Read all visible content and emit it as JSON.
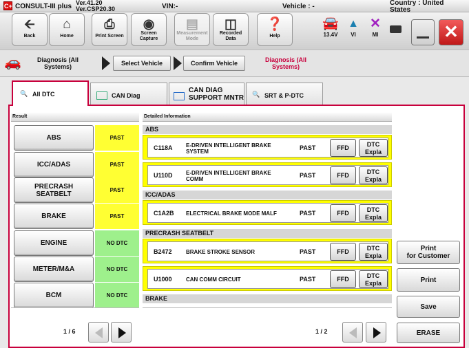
{
  "titlebar": {
    "logo": "C+",
    "app_name": "CONSULT-III plus",
    "ver_line1": "Ver.41.20",
    "ver_line2": "Ver.CSP20.30",
    "vin_label": "VIN:-",
    "vehicle_label": "Vehicle : -",
    "country_line1": "Country : United",
    "country_line2": "States"
  },
  "toolbar": {
    "back": "Back",
    "home": "Home",
    "print_screen": "Print Screen",
    "screen_capture": [
      "Screen",
      "Capture"
    ],
    "measurement_mode": [
      "Measurement",
      "Mode"
    ],
    "recorded_data": [
      "Recorded",
      "Data"
    ],
    "help": "Help",
    "battery_voltage": "13.4V",
    "vi_label": "VI",
    "mi_label": "MI"
  },
  "breadcrumb": {
    "diagnosis_all_systems": [
      "Diagnosis (All",
      "Systems)"
    ],
    "select_vehicle": "Select Vehicle",
    "confirm_vehicle": "Confirm Vehicle",
    "current": [
      "Diagnosis (All",
      "Systems)"
    ],
    "current_color": "#c8003c"
  },
  "tabs": {
    "all_dtc": "All DTC",
    "can_diag": "CAN Diag",
    "can_diag_support": [
      "CAN DIAG",
      "SUPPORT MNTR"
    ],
    "srt_pdtc": "SRT & P-DTC"
  },
  "result": {
    "header": "Result",
    "systems": [
      {
        "name": "ABS",
        "status": "PAST"
      },
      {
        "name": "ICC/ADAS",
        "status": "PAST"
      },
      {
        "name": "PRECRASH SEATBELT",
        "status": "PAST"
      },
      {
        "name": "BRAKE",
        "status": "PAST"
      },
      {
        "name": "ENGINE",
        "status": "NO DTC"
      },
      {
        "name": "METER/M&A",
        "status": "NO DTC"
      },
      {
        "name": "BCM",
        "status": "NO DTC"
      }
    ],
    "page": "1 / 6"
  },
  "detail": {
    "header": "Detailed Information",
    "groups": {
      "abs": "ABS",
      "icc": "ICC/ADAS",
      "precrash": "PRECRASH SEATBELT",
      "brake": "BRAKE"
    },
    "rows": [
      {
        "code": "C118A",
        "desc": "E-DRIVEN INTELLIGENT BRAKE SYSTEM",
        "status": "PAST",
        "ffd": "FFD",
        "dtc1": "DTC",
        "dtc2": "Expla"
      },
      {
        "code": "U110D",
        "desc": "E-DRIVEN INTELLIGENT BRAKE COMM",
        "status": "PAST",
        "ffd": "FFD",
        "dtc1": "DTC",
        "dtc2": "Expla"
      },
      {
        "code": "C1A2B",
        "desc": "ELECTRICAL BRAKE MODE MALF",
        "status": "PAST",
        "ffd": "FFD",
        "dtc1": "DTC",
        "dtc2": "Expla"
      },
      {
        "code": "B2472",
        "desc": "BRAKE STROKE SENSOR",
        "status": "PAST",
        "ffd": "FFD",
        "dtc1": "DTC",
        "dtc2": "Expla"
      },
      {
        "code": "U1000",
        "desc": "CAN COMM CIRCUIT",
        "status": "PAST",
        "ffd": "FFD",
        "dtc1": "DTC",
        "dtc2": "Expla"
      }
    ],
    "page": "1 / 2"
  },
  "actions": {
    "print_customer": [
      "Print",
      "for Customer"
    ],
    "print": "Print",
    "save": "Save",
    "erase": "ERASE"
  },
  "colors": {
    "past": "#ffff33",
    "no_dtc": "#9ef08c",
    "accent": "#c8003c",
    "close": "#e03030"
  }
}
